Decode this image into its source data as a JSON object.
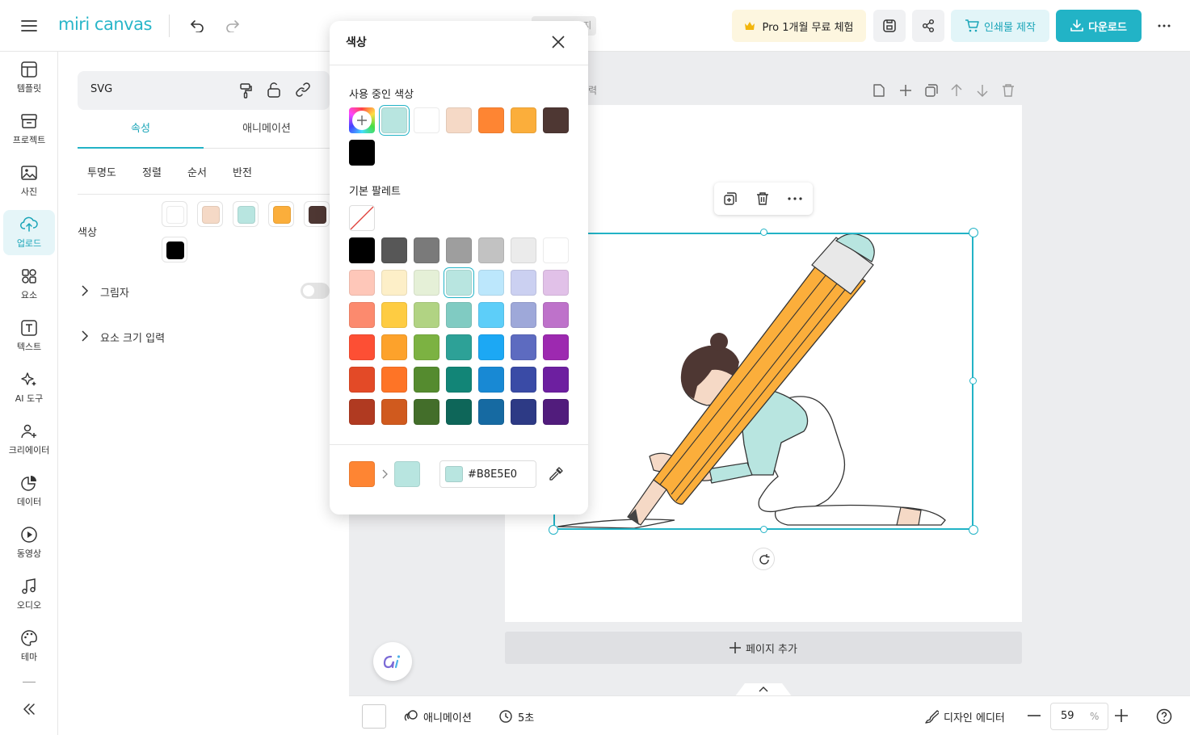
{
  "topbar": {
    "logo_text": "miri canvas",
    "hidden_title_fragment": "지",
    "pro_button": "Pro 1개월 무료 체험",
    "print_button": "인쇄물 제작",
    "download_button": "다운로드"
  },
  "rail": [
    {
      "label": "템플릿",
      "icon": "template-icon"
    },
    {
      "label": "프로젝트",
      "icon": "project-icon"
    },
    {
      "label": "사진",
      "icon": "photo-icon"
    },
    {
      "label": "업로드",
      "icon": "upload-icon"
    },
    {
      "label": "요소",
      "icon": "elements-icon"
    },
    {
      "label": "텍스트",
      "icon": "text-icon"
    },
    {
      "label": "AI 도구",
      "icon": "ai-tools-icon"
    },
    {
      "label": "크리에이터",
      "icon": "creator-icon"
    },
    {
      "label": "데이터",
      "icon": "data-icon"
    },
    {
      "label": "동영상",
      "icon": "video-icon"
    },
    {
      "label": "오디오",
      "icon": "audio-icon"
    },
    {
      "label": "테마",
      "icon": "theme-icon"
    }
  ],
  "panel": {
    "element_name": "SVG",
    "tabs": [
      "속성",
      "애니메이션"
    ],
    "active_tab": "속성",
    "subtabs": [
      "투명도",
      "정렬",
      "순서",
      "반전"
    ],
    "color_label": "색상",
    "colors": [
      "#FFFFFF",
      "#F5D9C6",
      "#B8E5E0",
      "#FBAE3B",
      "#4E3733",
      "#000000"
    ],
    "shadow_label": "그림자",
    "size_label": "요소 크기 입력"
  },
  "popup": {
    "title": "색상",
    "in_use_label": "사용 중인 색상",
    "in_use_colors": [
      "#B8E5E0",
      "#FFFFFF",
      "#F5D9C6",
      "#FE8533",
      "#FBAE3B",
      "#4E3733",
      "#000000"
    ],
    "basic_label": "기본 팔레트",
    "palette": [
      [
        "#000000",
        "#575757",
        "#7A7A7A",
        "#9E9E9E",
        "#C2C2C2",
        "#EBEBEB",
        "#FFFFFF"
      ],
      [
        "#FEC7B9",
        "#FDEFC8",
        "#E5F0D7",
        "#B8E5E0",
        "#BCE7FC",
        "#CBD0F1",
        "#E1C1E8"
      ],
      [
        "#FC8A6E",
        "#FECC42",
        "#B1D383",
        "#80CBC2",
        "#5DCEF9",
        "#9EA8D9",
        "#BE72CA"
      ],
      [
        "#FD4F34",
        "#FDA22B",
        "#7CB242",
        "#2DA197",
        "#1CA8F4",
        "#5D6BC0",
        "#9D29B0"
      ],
      [
        "#E34A27",
        "#FE7426",
        "#558B2F",
        "#128577",
        "#1889D4",
        "#3A4BA6",
        "#6D1FA0"
      ],
      [
        "#B03A21",
        "#D05A1E",
        "#436E2A",
        "#0E6659",
        "#166AA2",
        "#2D3A85",
        "#511C7C"
      ]
    ],
    "from_color": "#FE8533",
    "to_color": "#B8E5E0",
    "hex_value": "#B8E5E0"
  },
  "canvas": {
    "page_title_fragment": "력",
    "add_page": "페이지 추가"
  },
  "bottombar": {
    "animation": "애니메이션",
    "duration": "5초",
    "design_editor": "디자인 에디터",
    "zoom": "59",
    "zoom_unit": "%"
  }
}
